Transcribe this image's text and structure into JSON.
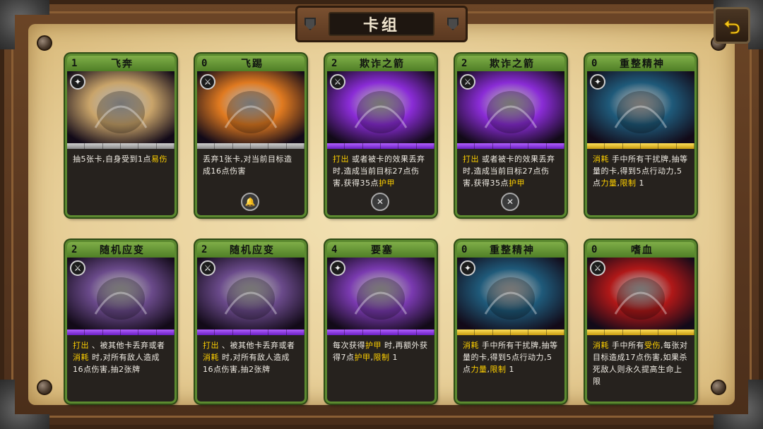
{
  "header": {
    "title": "卡组"
  },
  "cards": [
    {
      "cost": "1",
      "name": "飞奔",
      "bar": "gray",
      "type_icon": "skill-star-icon",
      "action_icon": "",
      "desc": [
        [
          "t",
          "抽5张卡,自身受到1点"
        ],
        [
          "k",
          "易伤"
        ]
      ]
    },
    {
      "cost": "0",
      "name": "飞踢",
      "bar": "gray",
      "type_icon": "sword-icon",
      "action_icon": "bell-icon",
      "desc": [
        [
          "t",
          "丢弃1张卡,对当前目标造成16点伤害"
        ]
      ]
    },
    {
      "cost": "2",
      "name": "欺诈之箭",
      "bar": "purple",
      "type_icon": "sword-icon",
      "action_icon": "crossbow-icon",
      "desc": [
        [
          "k",
          "打出"
        ],
        [
          "t",
          " 或者被卡的效果丢弃时,造成当前目标27点伤害,获得35点"
        ],
        [
          "k",
          "护甲"
        ]
      ]
    },
    {
      "cost": "2",
      "name": "欺诈之箭",
      "bar": "purple",
      "type_icon": "sword-icon",
      "action_icon": "crossbow-icon",
      "desc": [
        [
          "k",
          "打出"
        ],
        [
          "t",
          " 或者被卡的效果丢弃时,造成当前目标27点伤害,获得35点"
        ],
        [
          "k",
          "护甲"
        ]
      ]
    },
    {
      "cost": "0",
      "name": "重整精神",
      "bar": "gold",
      "type_icon": "skill-star-icon",
      "action_icon": "",
      "desc": [
        [
          "k",
          "消耗"
        ],
        [
          "t",
          " 手中所有干扰牌,抽等量的卡,得到5点行动力,5点"
        ],
        [
          "k",
          "力量"
        ],
        [
          "t",
          ","
        ],
        [
          "k",
          "限制"
        ],
        [
          "t",
          " 1"
        ]
      ]
    },
    {
      "cost": "2",
      "name": "随机应变",
      "bar": "purple",
      "type_icon": "sword-icon",
      "action_icon": "",
      "desc": [
        [
          "k",
          "打出"
        ],
        [
          "t",
          " 、被其他卡丢弃或者"
        ],
        [
          "k",
          "消耗"
        ],
        [
          "t",
          " 时,对所有敌人造成16点伤害,抽2张牌"
        ]
      ]
    },
    {
      "cost": "2",
      "name": "随机应变",
      "bar": "purple",
      "type_icon": "sword-icon",
      "action_icon": "",
      "desc": [
        [
          "k",
          "打出"
        ],
        [
          "t",
          " 、被其他卡丢弃或者"
        ],
        [
          "k",
          "消耗"
        ],
        [
          "t",
          " 时,对所有敌人造成16点伤害,抽2张牌"
        ]
      ]
    },
    {
      "cost": "4",
      "name": "要塞",
      "bar": "purple",
      "type_icon": "skill-star-icon",
      "action_icon": "",
      "desc": [
        [
          "t",
          "每次获得"
        ],
        [
          "k",
          "护甲"
        ],
        [
          "t",
          " 时,再额外获得7点"
        ],
        [
          "k",
          "护甲"
        ],
        [
          "t",
          ","
        ],
        [
          "k",
          "限制"
        ],
        [
          "t",
          " 1"
        ]
      ]
    },
    {
      "cost": "0",
      "name": "重整精神",
      "bar": "gold",
      "type_icon": "skill-star-icon",
      "action_icon": "",
      "desc": [
        [
          "k",
          "消耗"
        ],
        [
          "t",
          " 手中所有干扰牌,抽等量的卡,得到5点行动力,5点"
        ],
        [
          "k",
          "力量"
        ],
        [
          "t",
          ","
        ],
        [
          "k",
          "限制"
        ],
        [
          "t",
          " 1"
        ]
      ]
    },
    {
      "cost": "0",
      "name": "嗜血",
      "bar": "gold",
      "type_icon": "sword-icon",
      "action_icon": "",
      "desc": [
        [
          "k",
          "消耗"
        ],
        [
          "t",
          " 手中所有"
        ],
        [
          "k",
          "受伤"
        ],
        [
          "t",
          ",每张对目标造成17点伤害,如果杀死敌人则永久提高生命上限"
        ]
      ]
    }
  ],
  "art_colors": [
    "#c9a46a",
    "#e07a20",
    "#8a2cd6",
    "#8a2cd6",
    "#1f5a7a",
    "#6a4a8a",
    "#6a4a8a",
    "#7a3ab0",
    "#1f5a7a",
    "#b01818"
  ]
}
